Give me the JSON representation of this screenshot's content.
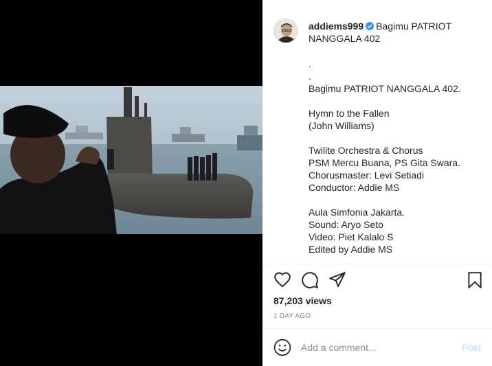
{
  "post": {
    "username": "addiems999",
    "verified_icon": "verified-badge-icon",
    "caption_title": "Bagimu PATRIOT NANGGALA 402",
    "caption_body": ".\n.\nBagimu PATRIOT NANGGALA 402.\n\nHymn to the Fallen\n(John Williams)\n\nTwilite Orchestra & Chorus\nPSM Mercu Buana, PS Gita Swara.\nChorusmaster: Levi Setiadi\nConductor: Addie MS\n\nAula Simfonia Jakarta.\nSound: Aryo Seto\nVideo: Piet Kalalo S\nEdited by Addie MS",
    "views": "87,203 views",
    "timestamp": "1 DAY AGO"
  },
  "actions": {
    "like_icon": "heart-icon",
    "comment_icon": "comment-icon",
    "share_icon": "share-icon",
    "save_icon": "bookmark-icon"
  },
  "comment": {
    "placeholder": "Add a comment...",
    "post_label": "Post",
    "emoji_icon": "emoji-icon"
  },
  "colors": {
    "verified": "#3897f0",
    "link_disabled": "#b2dffc",
    "muted": "#8e8e8e",
    "text": "#262626"
  }
}
